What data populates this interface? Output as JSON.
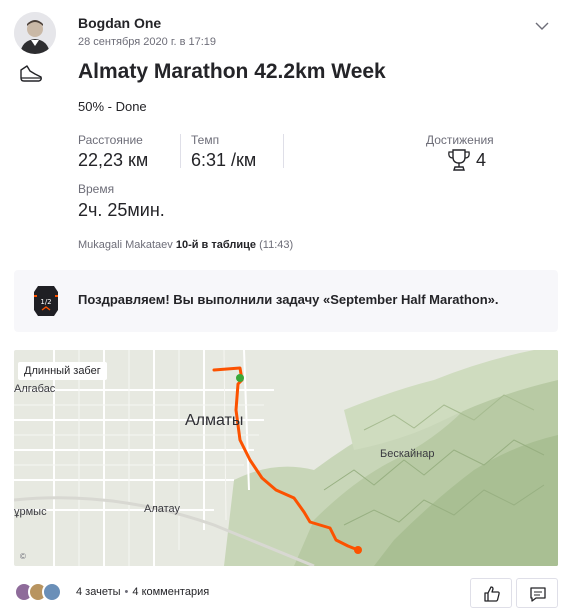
{
  "header": {
    "author_name": "Bogdan One",
    "date": "28 сентября 2020 г. в 17:19"
  },
  "activity": {
    "sport_icon": "shoe-icon",
    "title": "Almaty Marathon 42.2km Week",
    "description": "50% - Done"
  },
  "stats": {
    "distance_label": "Расстояние",
    "distance_value": "22,23 км",
    "pace_label": "Темп",
    "pace_value": "6:31 /км",
    "achievements_label": "Достижения",
    "achievements_value": "4",
    "time_label": "Время",
    "time_value": "2ч. 25мин."
  },
  "segment": {
    "name": "Mukagali Makataev",
    "rank": "10-й в таблице",
    "time": "(11:43)"
  },
  "challenge": {
    "text": "Поздравляем! Вы выполнили задачу «September Half Marathon»."
  },
  "map": {
    "route_type": "Длинный забег",
    "labels": {
      "algabas": "Алгабас",
      "almaty": "Алматы",
      "beskainar": "Бескайнар",
      "alatau": "Алатау",
      "urmys": "ұрмыс"
    },
    "route_color": "#fc5200"
  },
  "social": {
    "kudos": "4 зачеты",
    "separator": "•",
    "comments": "4 комментария"
  },
  "colors": {
    "text": "#242428",
    "muted": "#6d6d78",
    "accent": "#fc5200"
  }
}
